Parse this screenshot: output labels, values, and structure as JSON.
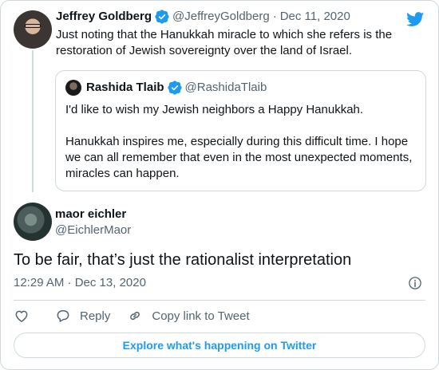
{
  "colors": {
    "accent": "#1d9bf0",
    "muted": "#536471",
    "border": "#cfd9de",
    "text": "#0f1419"
  },
  "parent_tweet": {
    "name": "Jeffrey Goldberg",
    "handle": "@JeffreyGoldberg",
    "separator": "·",
    "date": "Dec 11, 2020",
    "text": "Just noting that the Hanukkah miracle to which she refers is the restoration of Jewish sovereignty over the land of Israel.",
    "verified_icon": "verified-badge-icon",
    "avatar_icon": "profile-photo"
  },
  "quoted_tweet": {
    "name": "Rashida Tlaib",
    "handle": "@RashidaTlaib",
    "paragraphs": [
      "I'd like to wish my Jewish neighbors a Happy Hanukkah.",
      "Hanukkah inspires me, especially during this difficult time. I hope we can all remember that even in the most unexpected moments, miracles can happen."
    ]
  },
  "reply_tweet": {
    "name": "maor eichler",
    "handle": "@EichlerMaor",
    "text": "To be fair, that’s just the rationalist interpretation",
    "time": "12:29 AM · Dec 13, 2020"
  },
  "actions": {
    "reply_label": "Reply",
    "copy_label": "Copy link to Tweet"
  },
  "explore_label": "Explore what's happening on Twitter",
  "icons": {
    "brand": "twitter-bird-icon",
    "info": "info-icon",
    "like": "heart-icon",
    "reply": "speech-bubble-icon",
    "copy": "link-icon"
  }
}
